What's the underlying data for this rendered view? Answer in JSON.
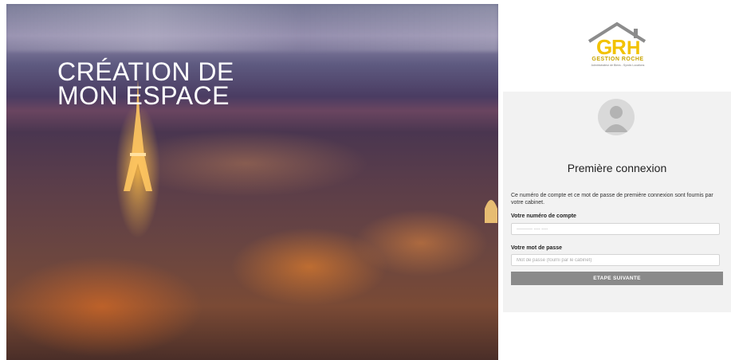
{
  "hero": {
    "title": "CRÉATION DE\nMON ESPACE"
  },
  "logo": {
    "name": "GESTION ROCHE",
    "tagline": "Administrateur de Biens - Syndic Locations"
  },
  "login": {
    "avatar_icon": "user-avatar-icon",
    "title": "Première connexion",
    "description": "Ce numéro de compte et ce mot de passe de première connexion sont fournis par votre cabinet.",
    "account_label": "Votre numéro de compte",
    "account_placeholder": "---------- ---- ----",
    "password_label": "Votre mot de passe",
    "password_placeholder": "Mot de passe (fourni par le cabinet)",
    "submit_label": "ETAPE SUIVANTE"
  },
  "colors": {
    "brand_gold": "#f2c200",
    "brand_grey": "#8a8a8a",
    "button": "#8a8a8a",
    "panel": "#f2f2f2"
  }
}
